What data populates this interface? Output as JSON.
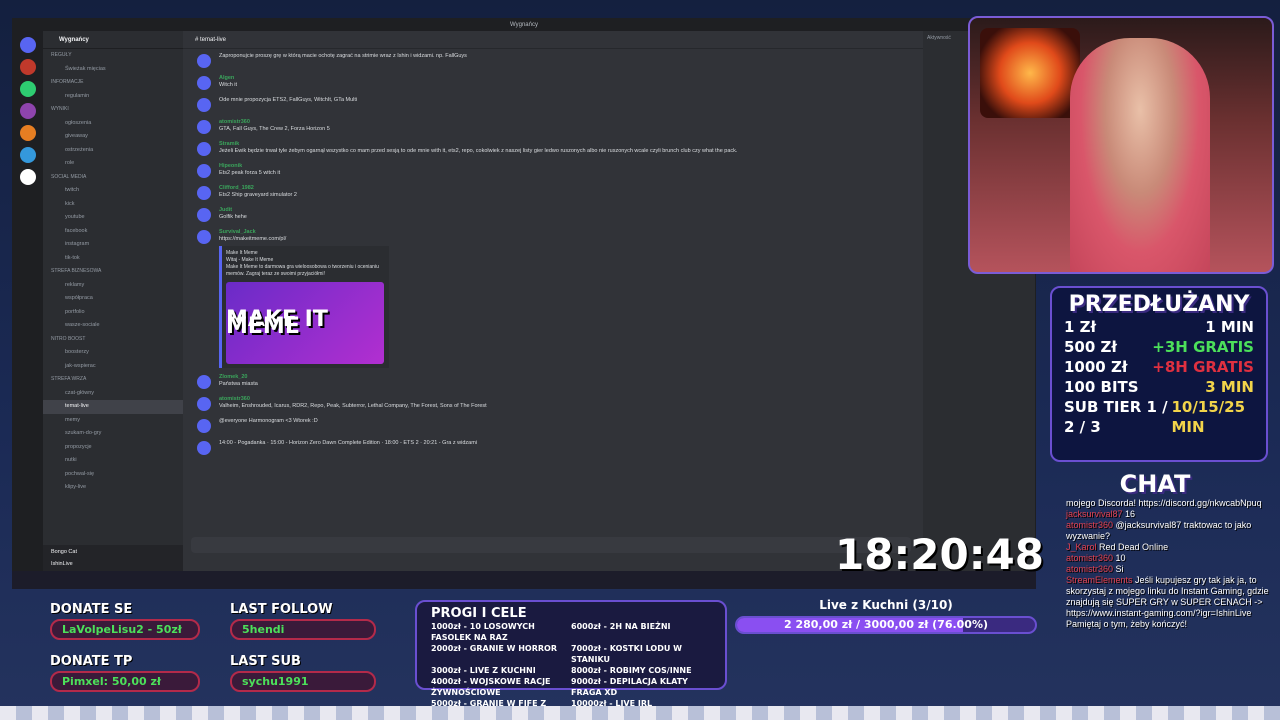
{
  "window_title": "Wygnańcy",
  "server": {
    "name": "Wygnańcy"
  },
  "channels": [
    {
      "label": "Reguły",
      "kind": "cat"
    },
    {
      "label": "Świeżak mięcias",
      "kind": "ch"
    },
    {
      "label": "INFORMACJE",
      "kind": "cat"
    },
    {
      "label": "regulamin",
      "kind": "ch"
    },
    {
      "label": "WYNIKI",
      "kind": "cat"
    },
    {
      "label": "ogłoszenia",
      "kind": "ch"
    },
    {
      "label": "giveaway",
      "kind": "ch"
    },
    {
      "label": "ostrzeżenia",
      "kind": "ch"
    },
    {
      "label": "role",
      "kind": "ch"
    },
    {
      "label": "SOCIAL MEDIA",
      "kind": "cat"
    },
    {
      "label": "twitch",
      "kind": "ch"
    },
    {
      "label": "kick",
      "kind": "ch"
    },
    {
      "label": "youtube",
      "kind": "ch"
    },
    {
      "label": "facebook",
      "kind": "ch"
    },
    {
      "label": "instagram",
      "kind": "ch"
    },
    {
      "label": "tik-tok",
      "kind": "ch"
    },
    {
      "label": "STREFA BIZNESOWA",
      "kind": "cat"
    },
    {
      "label": "reklamy",
      "kind": "ch"
    },
    {
      "label": "współpraca",
      "kind": "ch"
    },
    {
      "label": "portfolio",
      "kind": "ch"
    },
    {
      "label": "wasze-sociale",
      "kind": "ch"
    },
    {
      "label": "NITRO BOOST",
      "kind": "cat"
    },
    {
      "label": "boosterzy",
      "kind": "ch"
    },
    {
      "label": "jak-wspierac",
      "kind": "ch"
    },
    {
      "label": "STREFA WRZA",
      "kind": "cat"
    },
    {
      "label": "czat-główny",
      "kind": "ch"
    },
    {
      "label": "temat-live",
      "kind": "active"
    },
    {
      "label": "memy",
      "kind": "ch"
    },
    {
      "label": "szukam-do-gry",
      "kind": "ch"
    },
    {
      "label": "propozycje",
      "kind": "ch"
    },
    {
      "label": "nutki",
      "kind": "ch"
    },
    {
      "label": "pochwal-się",
      "kind": "ch"
    },
    {
      "label": "klipy-live",
      "kind": "ch"
    }
  ],
  "user_panel": {
    "bot": "Bongo Cat",
    "name": "IshinLive"
  },
  "channel_header": "temat-live",
  "messages": [
    {
      "author": "",
      "text": "Zaproponujcie proszę grę w którą macie ochotę zagrać na strimie wraz z Ishin i widzami. np. FallGuys"
    },
    {
      "author": "Algen",
      "text": "Witch it"
    },
    {
      "author": "",
      "text": "Ode mnie propozycja ETS2, FallGuys, WitchIt, GTa Multi"
    },
    {
      "author": "atomistr360",
      "text": "GTA, Fall Guys, The Crew 2, Forza Horizon 5"
    },
    {
      "author": "Stramik",
      "text": "Jeżeli Ewik będzie trwał tyle żebym ogarnął wszystko co mam przed sesją to ode mnie with it, ets2, repo, cokolwiek z naszej listy gier ledwo ruszonych albo nie ruszonych wcale czyli brunch club czy what the pack."
    },
    {
      "author": "Hipeonik",
      "text": "Ets2 peak forza 5 witch it"
    },
    {
      "author": "Clifford_1982",
      "text": "Ets2 Ship graveyard simulator 2"
    },
    {
      "author": "Judit",
      "text": "Golfik hehe"
    },
    {
      "author": "Survival_Jack",
      "text": "https://makeitmeme.com/pl/"
    },
    {
      "author": "Zlomek_20",
      "text": "Państwa miasta"
    },
    {
      "author": "atomistr360",
      "text": "Valheim, Enshrouded, Icarus, RDR2, Repo, Peak, Subterror, Lethal Company, The Forest, Sons of The Forest"
    },
    {
      "author": "",
      "text": "@everyone Harmonogram <3 Wtorek :D"
    },
    {
      "author": "",
      "text": "14:00 - Pogadanka · 15:00 - Horizon Zero Dawn Complete Edition · 18:00 - ETS 2 · 20:21 - Gra z widzami"
    }
  ],
  "embed": {
    "site": "Make It Meme",
    "title": "Witaj - Make It Meme",
    "desc": "Make It Meme to darmowa gra wieloosobowa o tworzeniu i ocenianiu memów. Zagraj teraz ze swoimi przyjaciółmi!",
    "image_text": "MAKE IT MEME"
  },
  "members_header": "Aktywność",
  "clock": "18:20:48",
  "promo": {
    "title": "PRZEDŁUŻANY",
    "rows": [
      {
        "left": "1 Zł",
        "right": "1 MIN"
      },
      {
        "left": "500 Zł",
        "right": "+3H GRATIS"
      },
      {
        "left": "1000 Zł",
        "right": "+8H GRATIS"
      },
      {
        "left": "100 BITS",
        "right": "3 MIN"
      },
      {
        "left": "SUB TIER 1 / 2 / 3",
        "right": "10/15/25 MIN"
      }
    ]
  },
  "chat": {
    "title": "CHAT",
    "lines": [
      {
        "name": "",
        "text": "mojego Discorda! https://discord.gg/nkwcabNpuq"
      },
      {
        "name": "jacksurvival87",
        "text": "16"
      },
      {
        "name": "atomistr360",
        "text": "@jacksurvival87 traktowac to jako wyzwanie?"
      },
      {
        "name": "J_Karol",
        "text": "Red Dead Online"
      },
      {
        "name": "atomistr360",
        "text": "10"
      },
      {
        "name": "atomistr360",
        "text": "Si"
      },
      {
        "name": "StreamElements",
        "text": "Jeśli kupujesz gry tak jak ja, to skorzystaj z mojego linku do Instant Gaming, gdzie znajdują się SUPER GRY w SUPER CENACH -> https://www.instant-gaming.com/?igr=IshinLive Pamiętaj o tym, żeby kończyć!"
      }
    ]
  },
  "donate": {
    "title": "DONATE SE",
    "value": "LaVolpeLisu2 - 50zł"
  },
  "donate_tp": {
    "title": "DONATE TP",
    "value": "Pimxel: 50,00 zł"
  },
  "last_follow": {
    "title": "LAST FOLLOW",
    "value": "5hendi"
  },
  "last_sub": {
    "title": "LAST SUB",
    "value": "sychu1991"
  },
  "goals": {
    "title": "PROGI I CELE",
    "items": [
      "1000zł - 10 LOSOWYCH FASOLEK NA RAZ",
      "6000zł - 2H NA BIEŻNI",
      "2000zł - GRANIE W HORROR",
      "7000zł - KOSTKI LODU W STANIKU",
      "3000zł - LIVE Z KUCHNI",
      "8000zł - ROBIMY COS/INNE",
      "4000zł - WOJSKOWE RACJE ŻYWNOŚCIOWE",
      "9000zł - DEPILACJA KLATY FRAGA XD",
      "5000zł - GRANIE W FIFE Z FRAGIEM",
      "10000zł - LIVE IRL"
    ]
  },
  "live_goal": {
    "title": "Live z Kuchni (3/10)",
    "label": "2 280,00 zł / 3000,00 zł (76.00%)",
    "progress": 0.76
  },
  "colors": {
    "accent": "#5865f2",
    "promo_green": "#4ce05a",
    "promo_red": "#e03040"
  }
}
